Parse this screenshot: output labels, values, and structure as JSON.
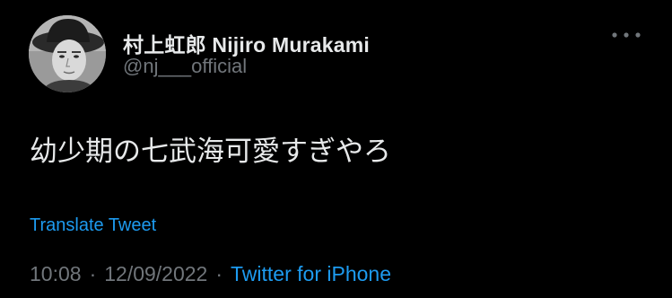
{
  "tweet": {
    "author": {
      "display_name": "村上虹郎 Nijiro Murakami",
      "handle": "@nj___official",
      "avatar_icon": "profile-photo"
    },
    "more_icon": "more-horizontal-icon",
    "text": "幼少期の七武海可愛すぎやろ",
    "translate_label": "Translate Tweet",
    "time": "10:08",
    "separator": "·",
    "date": "12/09/2022",
    "source": "Twitter for iPhone"
  },
  "colors": {
    "background": "#000000",
    "primary_text": "#e7e9ea",
    "secondary_text": "#71767b",
    "link": "#1d9bf0"
  }
}
